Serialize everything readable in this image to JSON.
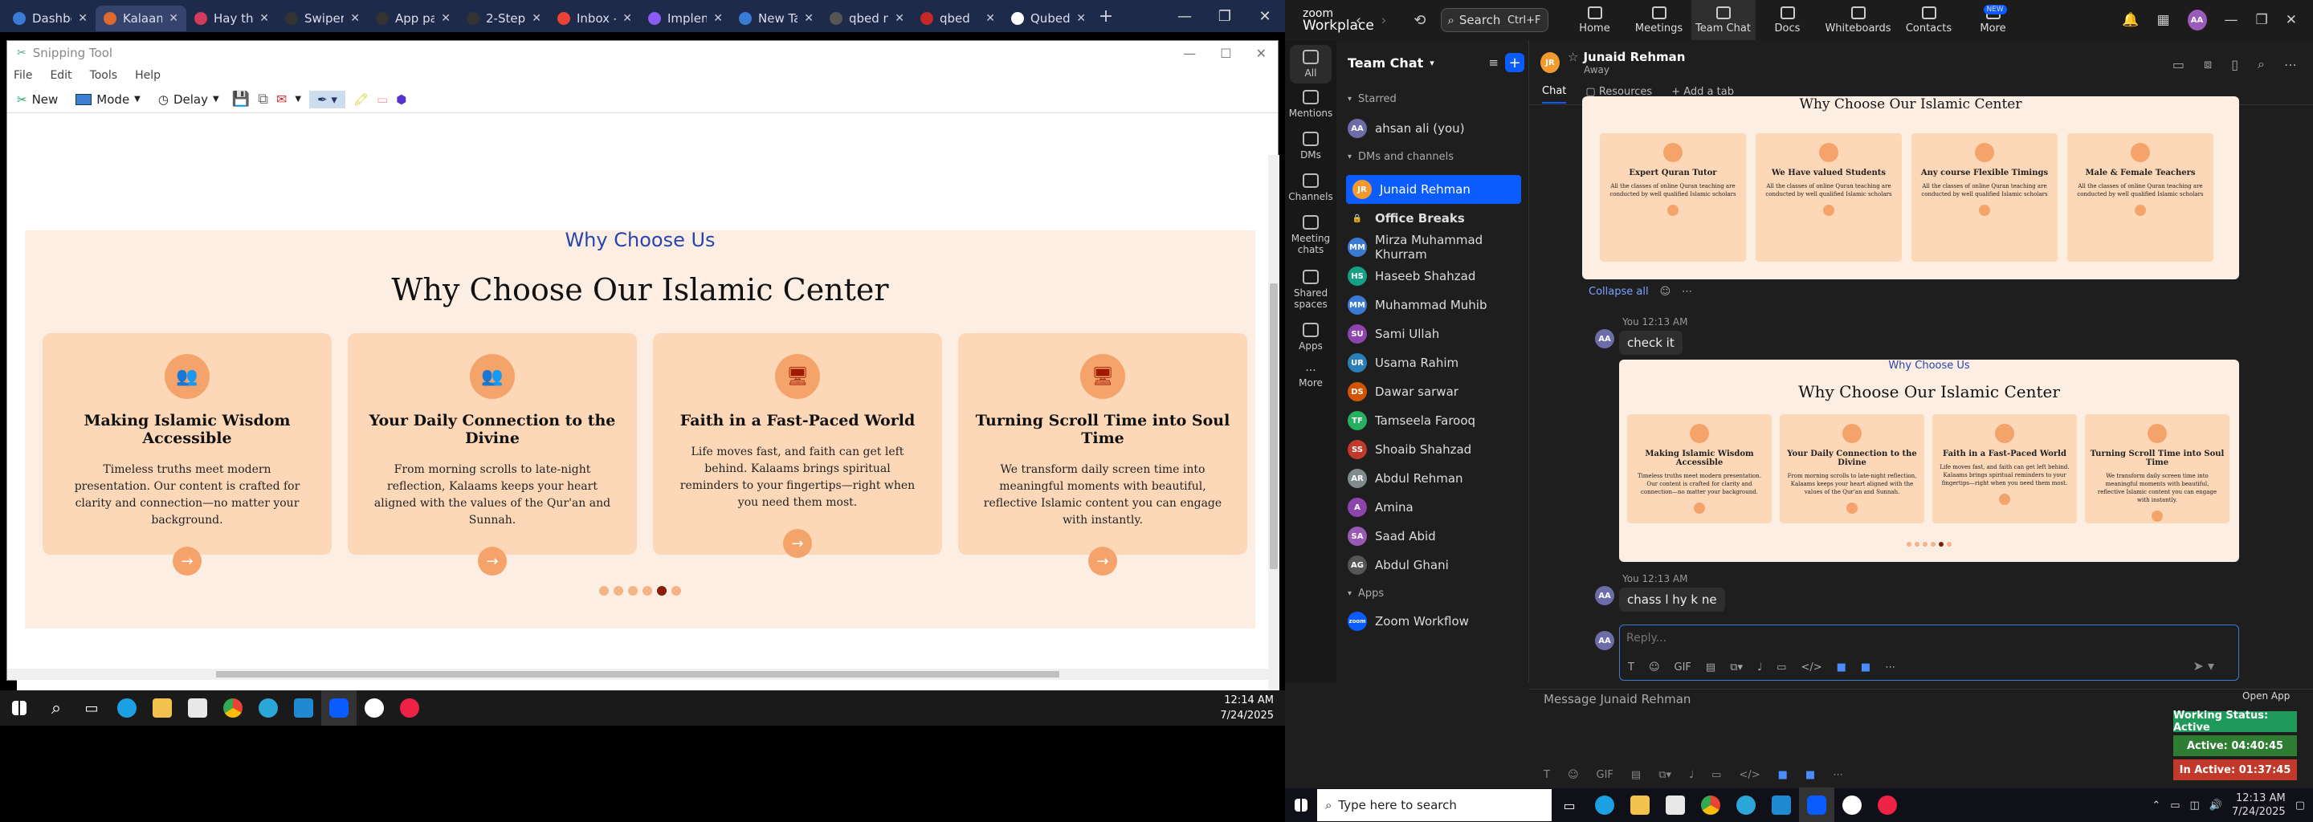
{
  "browser": {
    "tabs": [
      {
        "label": "Dashbo",
        "color": "#3a7bd5"
      },
      {
        "label": "Kalaam",
        "color": "#e06a2c",
        "active": true
      },
      {
        "label": "Hay tha",
        "color": "#d23c5a"
      },
      {
        "label": "Swiper",
        "color": "#333333"
      },
      {
        "label": "App pa",
        "color": "#333333"
      },
      {
        "label": "2-Step",
        "color": "#333333"
      },
      {
        "label": "Inbox -",
        "color": "#ea4335"
      },
      {
        "label": "Implem",
        "color": "#8a5cf5"
      },
      {
        "label": "New Ta",
        "color": "#3a7bd5"
      },
      {
        "label": "qbed n",
        "color": "#555555"
      },
      {
        "label": "qbed",
        "color": "#c62828"
      },
      {
        "label": "Qubed",
        "color": "#ffffff"
      }
    ],
    "new_tab": "+"
  },
  "snipping": {
    "title": "Snipping Tool",
    "menu": [
      "File",
      "Edit",
      "Tools",
      "Help"
    ],
    "toolbar": {
      "new": "New",
      "mode": "Mode",
      "delay": "Delay"
    }
  },
  "website": {
    "subtitle": "Why Choose Us",
    "title": "Why Choose Our Islamic Center",
    "cards": [
      {
        "title": "Making Islamic Wisdom Accessible",
        "text": "Timeless truths meet modern presentation. Our content is crafted for clarity and connection—no matter your background."
      },
      {
        "title": "Your Daily Connection to the Divine",
        "text": "From morning scrolls to late-night reflection, Kalaams keeps your heart aligned with the values of the Qur'an and Sunnah."
      },
      {
        "title": "Faith in a Fast-Paced World",
        "text": "Life moves fast, and faith can get left behind. Kalaams brings spiritual reminders to your fingertips—right when you need them most."
      },
      {
        "title": "Turning Scroll Time into Soul Time",
        "text": "We transform daily screen time into meaningful moments with beautiful, reflective Islamic content you can engage with instantly."
      }
    ],
    "arrow": "→",
    "dots": 6,
    "active_dot": 4
  },
  "taskbar_left": {
    "time": "12:14 AM",
    "date": "7/24/2025"
  },
  "zoom": {
    "brand_top": "zoom",
    "brand_bottom": "Workplace",
    "search": "Search",
    "search_shortcut": "Ctrl+F",
    "nav": [
      "Home",
      "Meetings",
      "Team Chat",
      "Docs",
      "Whiteboards",
      "Contacts",
      "More"
    ],
    "new_badge": "NEW",
    "user_initials": "AA",
    "rail": [
      "All",
      "Mentions",
      "DMs",
      "Channels",
      "Meeting chats",
      "Shared spaces",
      "Apps",
      "More"
    ],
    "list_title": "Team Chat",
    "starred": "Starred",
    "me": {
      "initials": "AA",
      "name": "ahsan ali (you)",
      "color": "#6c6ca8"
    },
    "dms_label": "DMs and channels",
    "contacts": [
      {
        "initials": "JR",
        "name": "Junaid Rehman",
        "color": "#f29a2e",
        "sel": true
      },
      {
        "initials": "🔒",
        "name": "Office Breaks",
        "color": "#1e1e1e",
        "bold": true
      },
      {
        "initials": "MM",
        "name": "Mirza Muhammad Khurram",
        "color": "#3a7bd5"
      },
      {
        "initials": "HS",
        "name": "Haseeb Shahzad",
        "color": "#16a085"
      },
      {
        "initials": "MM",
        "name": "Muhammad Muhib",
        "color": "#3a7bd5"
      },
      {
        "initials": "SU",
        "name": "Sami Ullah",
        "color": "#8e44ad"
      },
      {
        "initials": "UR",
        "name": "Usama Rahim",
        "color": "#2980b9"
      },
      {
        "initials": "DS",
        "name": "Dawar sarwar",
        "color": "#d35400"
      },
      {
        "initials": "TF",
        "name": "Tamseela Farooq",
        "color": "#27ae60"
      },
      {
        "initials": "SS",
        "name": "Shoaib Shahzad",
        "color": "#c0392b"
      },
      {
        "initials": "AR",
        "name": "Abdul Rehman",
        "color": "#7f8c8d"
      },
      {
        "initials": "A",
        "name": "Amina",
        "color": "#8e44ad"
      },
      {
        "initials": "SA",
        "name": "Saad Abid",
        "color": "#9b59b6"
      },
      {
        "initials": "AG",
        "name": "Abdul Ghani",
        "color": "#555555"
      }
    ],
    "apps_label": "Apps",
    "app_item": {
      "initials": "zoom",
      "name": "Zoom Workflow",
      "color": "#0b5cff"
    },
    "header": {
      "initials": "JR",
      "name": "Junaid Rehman",
      "status": "Away"
    },
    "tabs": [
      "Chat",
      "Resources",
      "Add a tab"
    ],
    "mini1": {
      "cards": [
        {
          "title": "Expert Quran Tutor",
          "text": "All the classes of online Quran teaching are conducted by well qualified Islamic scholars"
        },
        {
          "title": "We Have valued Students",
          "text": "All the classes of online Quran teaching are conducted by well qualified Islamic scholars"
        },
        {
          "title": "Any course Flexible Timings",
          "text": "All the classes of online Quran teaching are conducted by well qualified Islamic scholars"
        },
        {
          "title": "Male & Female Teachers",
          "text": "All the classes of online Quran teaching are conducted by well qualified Islamic scholars"
        }
      ]
    },
    "collapse": "Collapse all",
    "msg1_meta": "You 12:13 AM",
    "msg1": "check it",
    "msg2_meta": "You 12:13 AM",
    "msg2": "chass l hy k ne",
    "reply_placeholder": "Reply...",
    "compose_placeholder": "Message Junaid Rehman",
    "open_app": "Open App",
    "status_working": "Working Status: Active",
    "status_active": "Active: 04:40:45",
    "status_inactive": "In Active: 01:37:45",
    "search_placeholder": "Type here to search",
    "time": "12:13 AM",
    "date": "7/24/2025"
  }
}
